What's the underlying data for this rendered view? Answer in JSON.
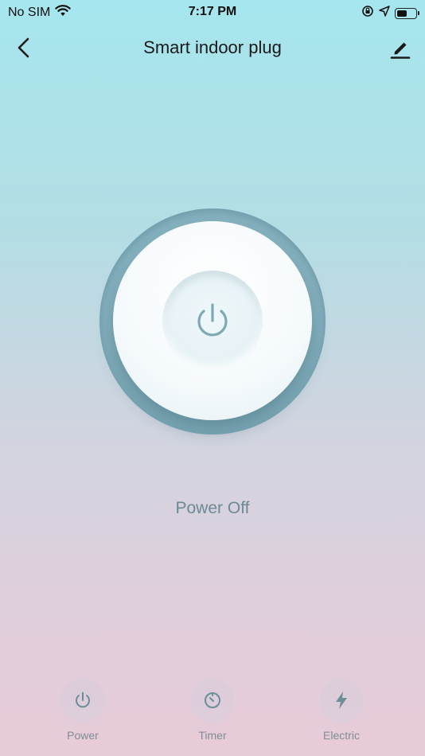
{
  "status_bar": {
    "carrier": "No SIM",
    "time": "7:17 PM",
    "battery_level": 0.55
  },
  "nav": {
    "title": "Smart indoor plug"
  },
  "main": {
    "power_state": "Power Off"
  },
  "tabs": [
    {
      "label": "Power",
      "icon": "power-icon"
    },
    {
      "label": "Timer",
      "icon": "timer-icon"
    },
    {
      "label": "Electric",
      "icon": "lightning-icon"
    }
  ],
  "colors": {
    "accent": "#7aa6b3",
    "icon": "#6b8e99"
  }
}
